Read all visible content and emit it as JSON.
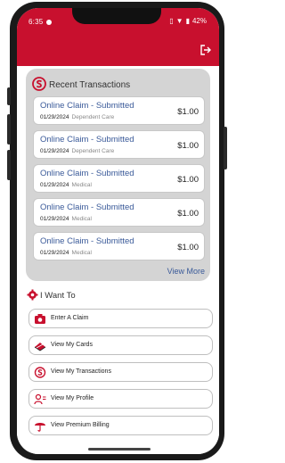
{
  "status_bar": {
    "time": "6:35",
    "battery": "42%"
  },
  "recent_transactions": {
    "title": "Recent Transactions",
    "items": [
      {
        "title": "Online Claim  - Submitted",
        "date": "01/29/2024",
        "category": "Dependent Care",
        "amount": "$1.00"
      },
      {
        "title": "Online Claim  - Submitted",
        "date": "01/29/2024",
        "category": "Dependent Care",
        "amount": "$1.00"
      },
      {
        "title": "Online Claim  - Submitted",
        "date": "01/29/2024",
        "category": "Medical",
        "amount": "$1.00"
      },
      {
        "title": "Online Claim  - Submitted",
        "date": "01/29/2024",
        "category": "Medical",
        "amount": "$1.00"
      },
      {
        "title": "Online Claim  - Submitted",
        "date": "01/29/2024",
        "category": "Medical",
        "amount": "$1.00"
      }
    ],
    "view_more": "View More"
  },
  "i_want_to": {
    "title": "I Want To",
    "actions": [
      {
        "label": "Enter A Claim",
        "icon": "camera-icon"
      },
      {
        "label": "View My Cards",
        "icon": "cards-icon"
      },
      {
        "label": "View My Transactions",
        "icon": "transactions-icon"
      },
      {
        "label": "View My Profile",
        "icon": "profile-icon"
      },
      {
        "label": "View Premium Billing",
        "icon": "umbrella-icon"
      }
    ]
  },
  "colors": {
    "brand_red": "#c8102e",
    "link_blue": "#3a5a99",
    "card_gray": "#d4d4d4"
  }
}
